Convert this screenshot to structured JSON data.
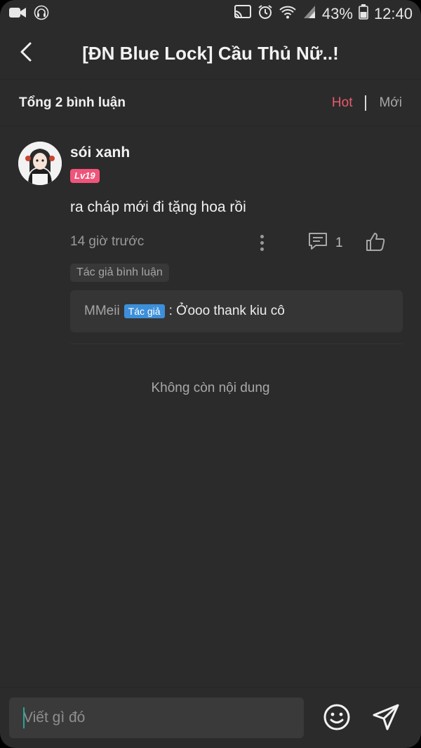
{
  "status_bar": {
    "battery": "43%",
    "time": "12:40"
  },
  "header": {
    "title": "[ĐN Blue Lock] Cầu Thủ Nữ..!"
  },
  "comments_header": {
    "total": "Tổng 2 bình luận",
    "sort_hot": "Hot",
    "sort_new": "Mới"
  },
  "comment": {
    "username": "sói xanh",
    "level": "Lv19",
    "content": "ra cháp mới đi tặng hoa rồi",
    "time": "14 giờ trước",
    "reply_count": "1",
    "author_section_label": "Tác giả bình luận",
    "author_reply": {
      "user": "MMeii",
      "badge": "Tác giả",
      "text": ": Ởooo thank kiu cô"
    }
  },
  "end_text": "Không còn nội dung",
  "composer": {
    "placeholder": "Viết gì đó"
  },
  "colors": {
    "background": "#2b2b2b",
    "accent_hot": "#e85a6e",
    "level_badge": "#f0547a",
    "author_badge": "#3d8fd9"
  },
  "icons": [
    "video-camera-icon",
    "headphone-icon",
    "cast-icon",
    "alarm-icon",
    "wifi-icon",
    "signal-icon",
    "battery-icon",
    "back-arrow-icon",
    "more-vertical-icon",
    "comment-icon",
    "thumbs-up-icon",
    "emoji-icon",
    "send-icon"
  ]
}
